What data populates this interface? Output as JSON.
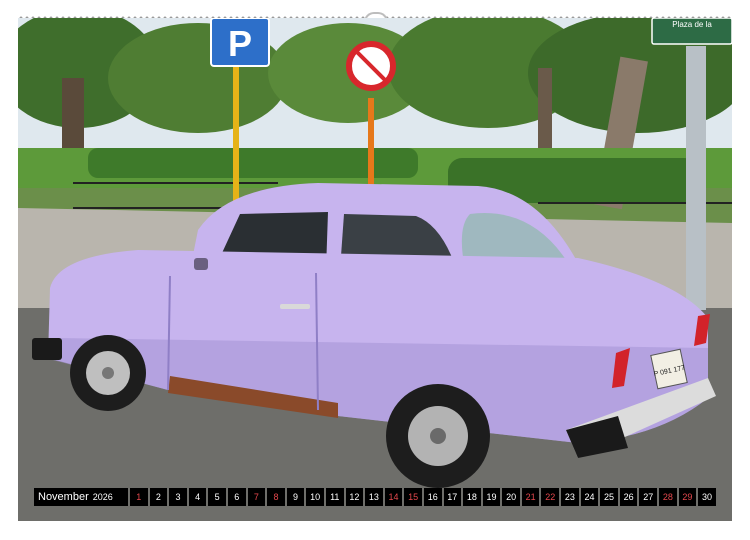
{
  "calendar": {
    "month": "November",
    "year": "2026",
    "days": [
      "1",
      "2",
      "3",
      "4",
      "5",
      "6",
      "7",
      "8",
      "9",
      "10",
      "11",
      "12",
      "13",
      "14",
      "15",
      "16",
      "17",
      "18",
      "19",
      "20",
      "21",
      "22",
      "23",
      "24",
      "25",
      "26",
      "27",
      "28",
      "29",
      "30"
    ],
    "sundays": [
      "1",
      "8",
      "15",
      "22",
      "29"
    ],
    "saturdays_red": [
      "7",
      "14",
      "21",
      "28"
    ]
  },
  "scene": {
    "parking_sign_letter": "P",
    "street_sign_text": "Plaza de la",
    "license_plate": "P 091 177",
    "colors": {
      "car_body": "#c7b4ee",
      "car_shadow": "#a493d6",
      "sky": "#dfe8ee",
      "foliage": "#4f7d33",
      "lawn": "#5d9a3a",
      "road": "#6e6e6a",
      "sign_blue": "#2d6fc9",
      "sign_red": "#d8272c",
      "street_sign_green": "#2d6b45"
    }
  }
}
